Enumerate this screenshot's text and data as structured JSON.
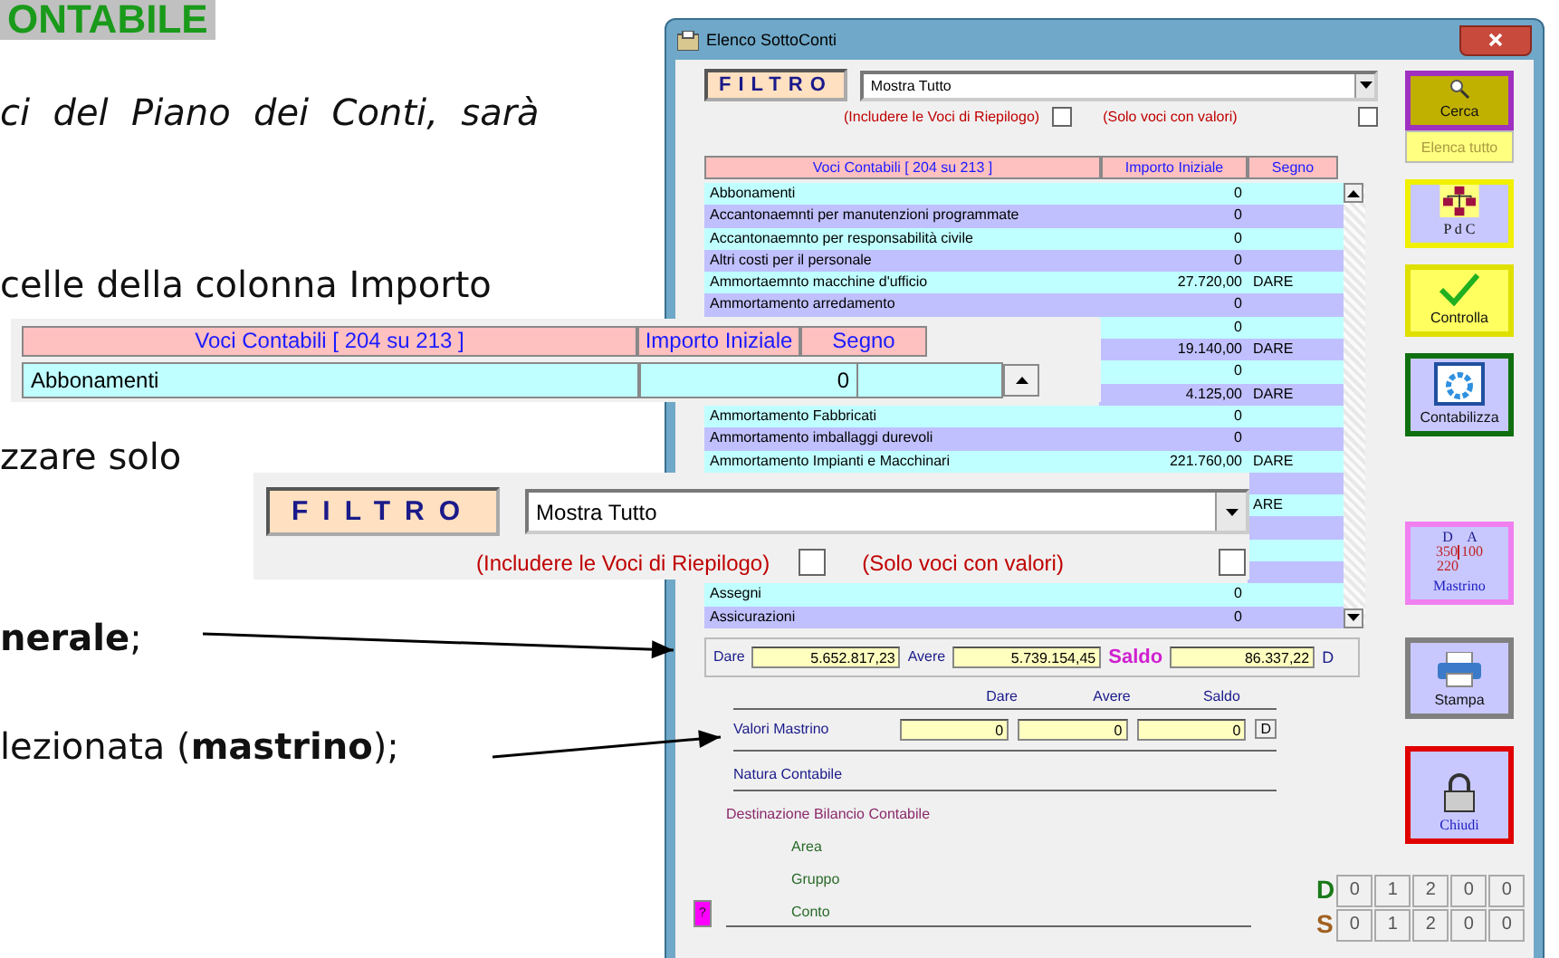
{
  "document": {
    "heading": "ONTABILE",
    "lines": [
      {
        "kind": "italic",
        "text": "ci  del  Piano  dei  Conti,  sarà"
      },
      {
        "kind": "plain",
        "text": "celle della colonna Importo"
      },
      {
        "kind": "plain",
        "text": "zzare solo"
      },
      {
        "kind": "plain",
        "text": "**nerale**;"
      },
      {
        "kind": "plain",
        "text": "lezionata (**mastrino**);"
      }
    ]
  },
  "window": {
    "title": "Elenco SottoConti",
    "filter": {
      "label": "FILTRO",
      "value": "Mostra Tutto",
      "options": [
        {
          "label": "(Includere le Voci di Riepilogo)",
          "checked": false
        },
        {
          "label": "(Solo voci con valori)",
          "checked": false
        }
      ]
    },
    "table": {
      "columns": [
        "Voci Contabili [ 204 su 213 ]",
        "Importo Iniziale",
        "Segno"
      ],
      "rows": [
        {
          "name": "Abbonamenti",
          "amount": "0"
        },
        {
          "name": "Accantonaemnti per manutenzioni programmate",
          "amount": "0"
        },
        {
          "name": "Accantonaemnto per responsabilità civile",
          "amount": "0"
        },
        {
          "name": "Altri costi per il personale",
          "amount": "0"
        },
        {
          "name": "Ammortaemnto macchine d'ufficio",
          "amount": "27.720,00",
          "sign": "DARE"
        },
        {
          "name": "Ammortamento arredamento",
          "amount": "0"
        },
        {
          "amount": "0"
        },
        {
          "amount": "19.140,00",
          "sign": "DARE"
        },
        {
          "amount": "0"
        },
        {
          "amount": "4.125,00",
          "sign": "DARE"
        },
        {
          "name": "Ammortamento Fabbricati",
          "amount": "0"
        },
        {
          "name": "Ammortamento imballaggi durevoli",
          "amount": "0"
        },
        {
          "name": "Ammortamento Impianti e Macchinari",
          "amount": "221.760,00",
          "sign": "DARE"
        },
        {},
        {
          "sign": "ARE"
        },
        {},
        {},
        {},
        {
          "name": "Assegni",
          "amount": "0"
        },
        {
          "name": "Assicurazioni",
          "amount": "0"
        }
      ]
    },
    "totals": {
      "dare_label": "Dare",
      "dare": "5.652.817,23",
      "avere_label": "Avere",
      "avere": "5.739.154,45",
      "saldo_label": "Saldo",
      "saldo": "86.337,22",
      "saldo_sign": "D"
    },
    "mastrino": {
      "columns": [
        "Dare",
        "Avere",
        "Saldo"
      ],
      "label": "Valori Mastrino",
      "values": [
        "0",
        "0",
        "0"
      ],
      "sign": "D"
    },
    "natura_label": "Natura Contabile",
    "destinazione_label": "Destinazione Bilancio Contabile",
    "destinazione_items": [
      "Area",
      "Gruppo",
      "Conto"
    ],
    "help_button": "?",
    "counters": [
      {
        "label": "D",
        "digits": [
          "0",
          "1",
          "2",
          "0",
          "0"
        ]
      },
      {
        "label": "S",
        "digits": [
          "0",
          "1",
          "2",
          "0",
          "0"
        ]
      }
    ],
    "buttons": [
      {
        "kind": "search",
        "label": "Cerca",
        "sublabel": "Elenca tutto"
      },
      {
        "kind": "chart",
        "label": "P d C"
      },
      {
        "kind": "check",
        "label": "Controlla"
      },
      {
        "kind": "gear",
        "label": "Contabilizza"
      },
      {
        "kind": "ledger",
        "label": "Mastrino",
        "ledger": [
          "D",
          "A",
          "350",
          "100",
          "220"
        ]
      },
      {
        "kind": "print",
        "label": "Stampa"
      },
      {
        "kind": "lock",
        "label": "Chiudi"
      }
    ]
  },
  "header_inset": {
    "columns": [
      "Voci Contabili [ 204 su 213 ]",
      "Importo Iniziale",
      "Segno"
    ],
    "name": "Abbonamenti",
    "amount": "0"
  },
  "filter_inset": {
    "label": "FILTRO",
    "value": "Mostra Tutto",
    "options": [
      {
        "label": "(Includere le Voci di Riepilogo)",
        "checked": false
      },
      {
        "label": "(Solo voci con valori)",
        "checked": false
      }
    ]
  }
}
